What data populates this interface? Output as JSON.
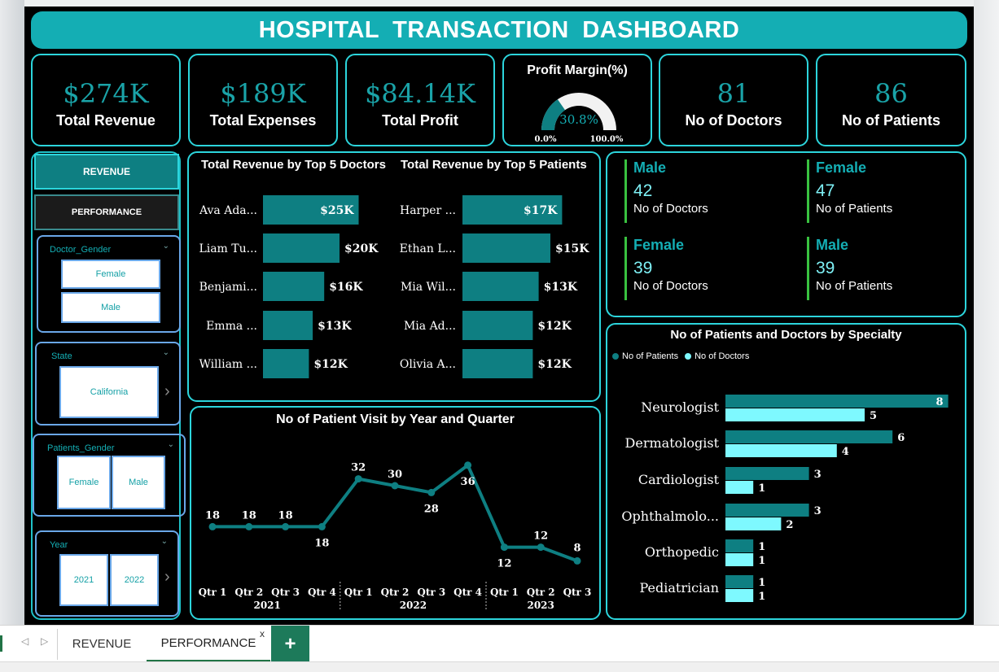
{
  "dashboard": {
    "title": "HOSPITAL TRANSACTION DASHBOARD",
    "colors": {
      "accent": "#14aeb4",
      "dark_teal": "#0e7f82",
      "light_cyan": "#7ef9ff",
      "border": "#2cd5dc",
      "green_bar": "#39c240"
    }
  },
  "kpis": [
    {
      "value": "$274K",
      "label": "Total Revenue"
    },
    {
      "value": "$189K",
      "label": "Total Expenses"
    },
    {
      "value": "$84.14K",
      "label": "Total Profit"
    },
    {
      "value": "81",
      "label": "No of  Doctors"
    },
    {
      "value": "86",
      "label": "No of Patients"
    }
  ],
  "profit_margin": {
    "title": "Profit Margin(%)",
    "value_label": "30.8%",
    "value": 30.8,
    "min_label": "0.0%",
    "max_label": "100.0%"
  },
  "nav": {
    "revenue_label": "REVENUE",
    "performance_label": "PERFORMANCE"
  },
  "slicers": {
    "doctor_gender": {
      "title": "Doctor_Gender",
      "options": [
        "Female",
        "Male"
      ]
    },
    "state": {
      "title": "State",
      "options": [
        "California"
      ]
    },
    "patients_gender": {
      "title": "Patients_Gender",
      "options": [
        "Female",
        "Male"
      ]
    },
    "year": {
      "title": "Year",
      "options": [
        "2021",
        "2022"
      ]
    }
  },
  "gender_stats": [
    {
      "head": "Male",
      "value": "42",
      "label": "No of Doctors"
    },
    {
      "head": "Female",
      "value": "47",
      "label": "No of Patients"
    },
    {
      "head": "Female",
      "value": "39",
      "label": "No of Doctors"
    },
    {
      "head": "Male",
      "value": "39",
      "label": "No of Patients"
    }
  ],
  "chart_data": [
    {
      "type": "bar",
      "title": "Total Revenue by Top 5 Doctors",
      "categories": [
        "Ava Ada...",
        "Liam Tu...",
        "Benjami...",
        "Emma ...",
        "William ..."
      ],
      "values": [
        25,
        20,
        16,
        13,
        12
      ],
      "value_labels": [
        "$25K",
        "$20K",
        "$16K",
        "$13K",
        "$12K"
      ],
      "orientation": "horizontal"
    },
    {
      "type": "bar",
      "title": "Total Revenue by Top 5 Patients",
      "categories": [
        "Harper ...",
        "Ethan L...",
        "Mia Wil...",
        "Mia Ad...",
        "Olivia A..."
      ],
      "values": [
        17,
        15,
        13,
        12,
        12
      ],
      "value_labels": [
        "$17K",
        "$15K",
        "$13K",
        "$12K",
        "$12K"
      ],
      "orientation": "horizontal"
    },
    {
      "type": "line",
      "title": "No of Patient Visit  by Year and Quarter",
      "x": [
        "Qtr 1",
        "Qtr 2",
        "Qtr 3",
        "Qtr 4",
        "Qtr 1",
        "Qtr 2",
        "Qtr 3",
        "Qtr 4",
        "Qtr 1",
        "Qtr 2",
        "Qtr 3"
      ],
      "groups": [
        "2021",
        "2022",
        "2023"
      ],
      "values": [
        18,
        18,
        18,
        18,
        32,
        30,
        28,
        36,
        12,
        12,
        8
      ]
    },
    {
      "type": "bar",
      "title": "No of Patients and Doctors by Specialty",
      "orientation": "horizontal",
      "categories": [
        "Neurologist",
        "Dermatologist",
        "Cardiologist",
        "Ophthalmolo...",
        "Orthopedic",
        "Pediatrician"
      ],
      "series": [
        {
          "name": "No of Patients",
          "values": [
            8,
            6,
            3,
            3,
            1,
            1
          ]
        },
        {
          "name": "No of Doctors",
          "values": [
            5,
            4,
            1,
            2,
            1,
            1
          ]
        }
      ],
      "legend": "top-left"
    }
  ],
  "tabs": {
    "revenue": "REVENUE",
    "performance": "PERFORMANCE",
    "close": "x",
    "add": "+"
  }
}
